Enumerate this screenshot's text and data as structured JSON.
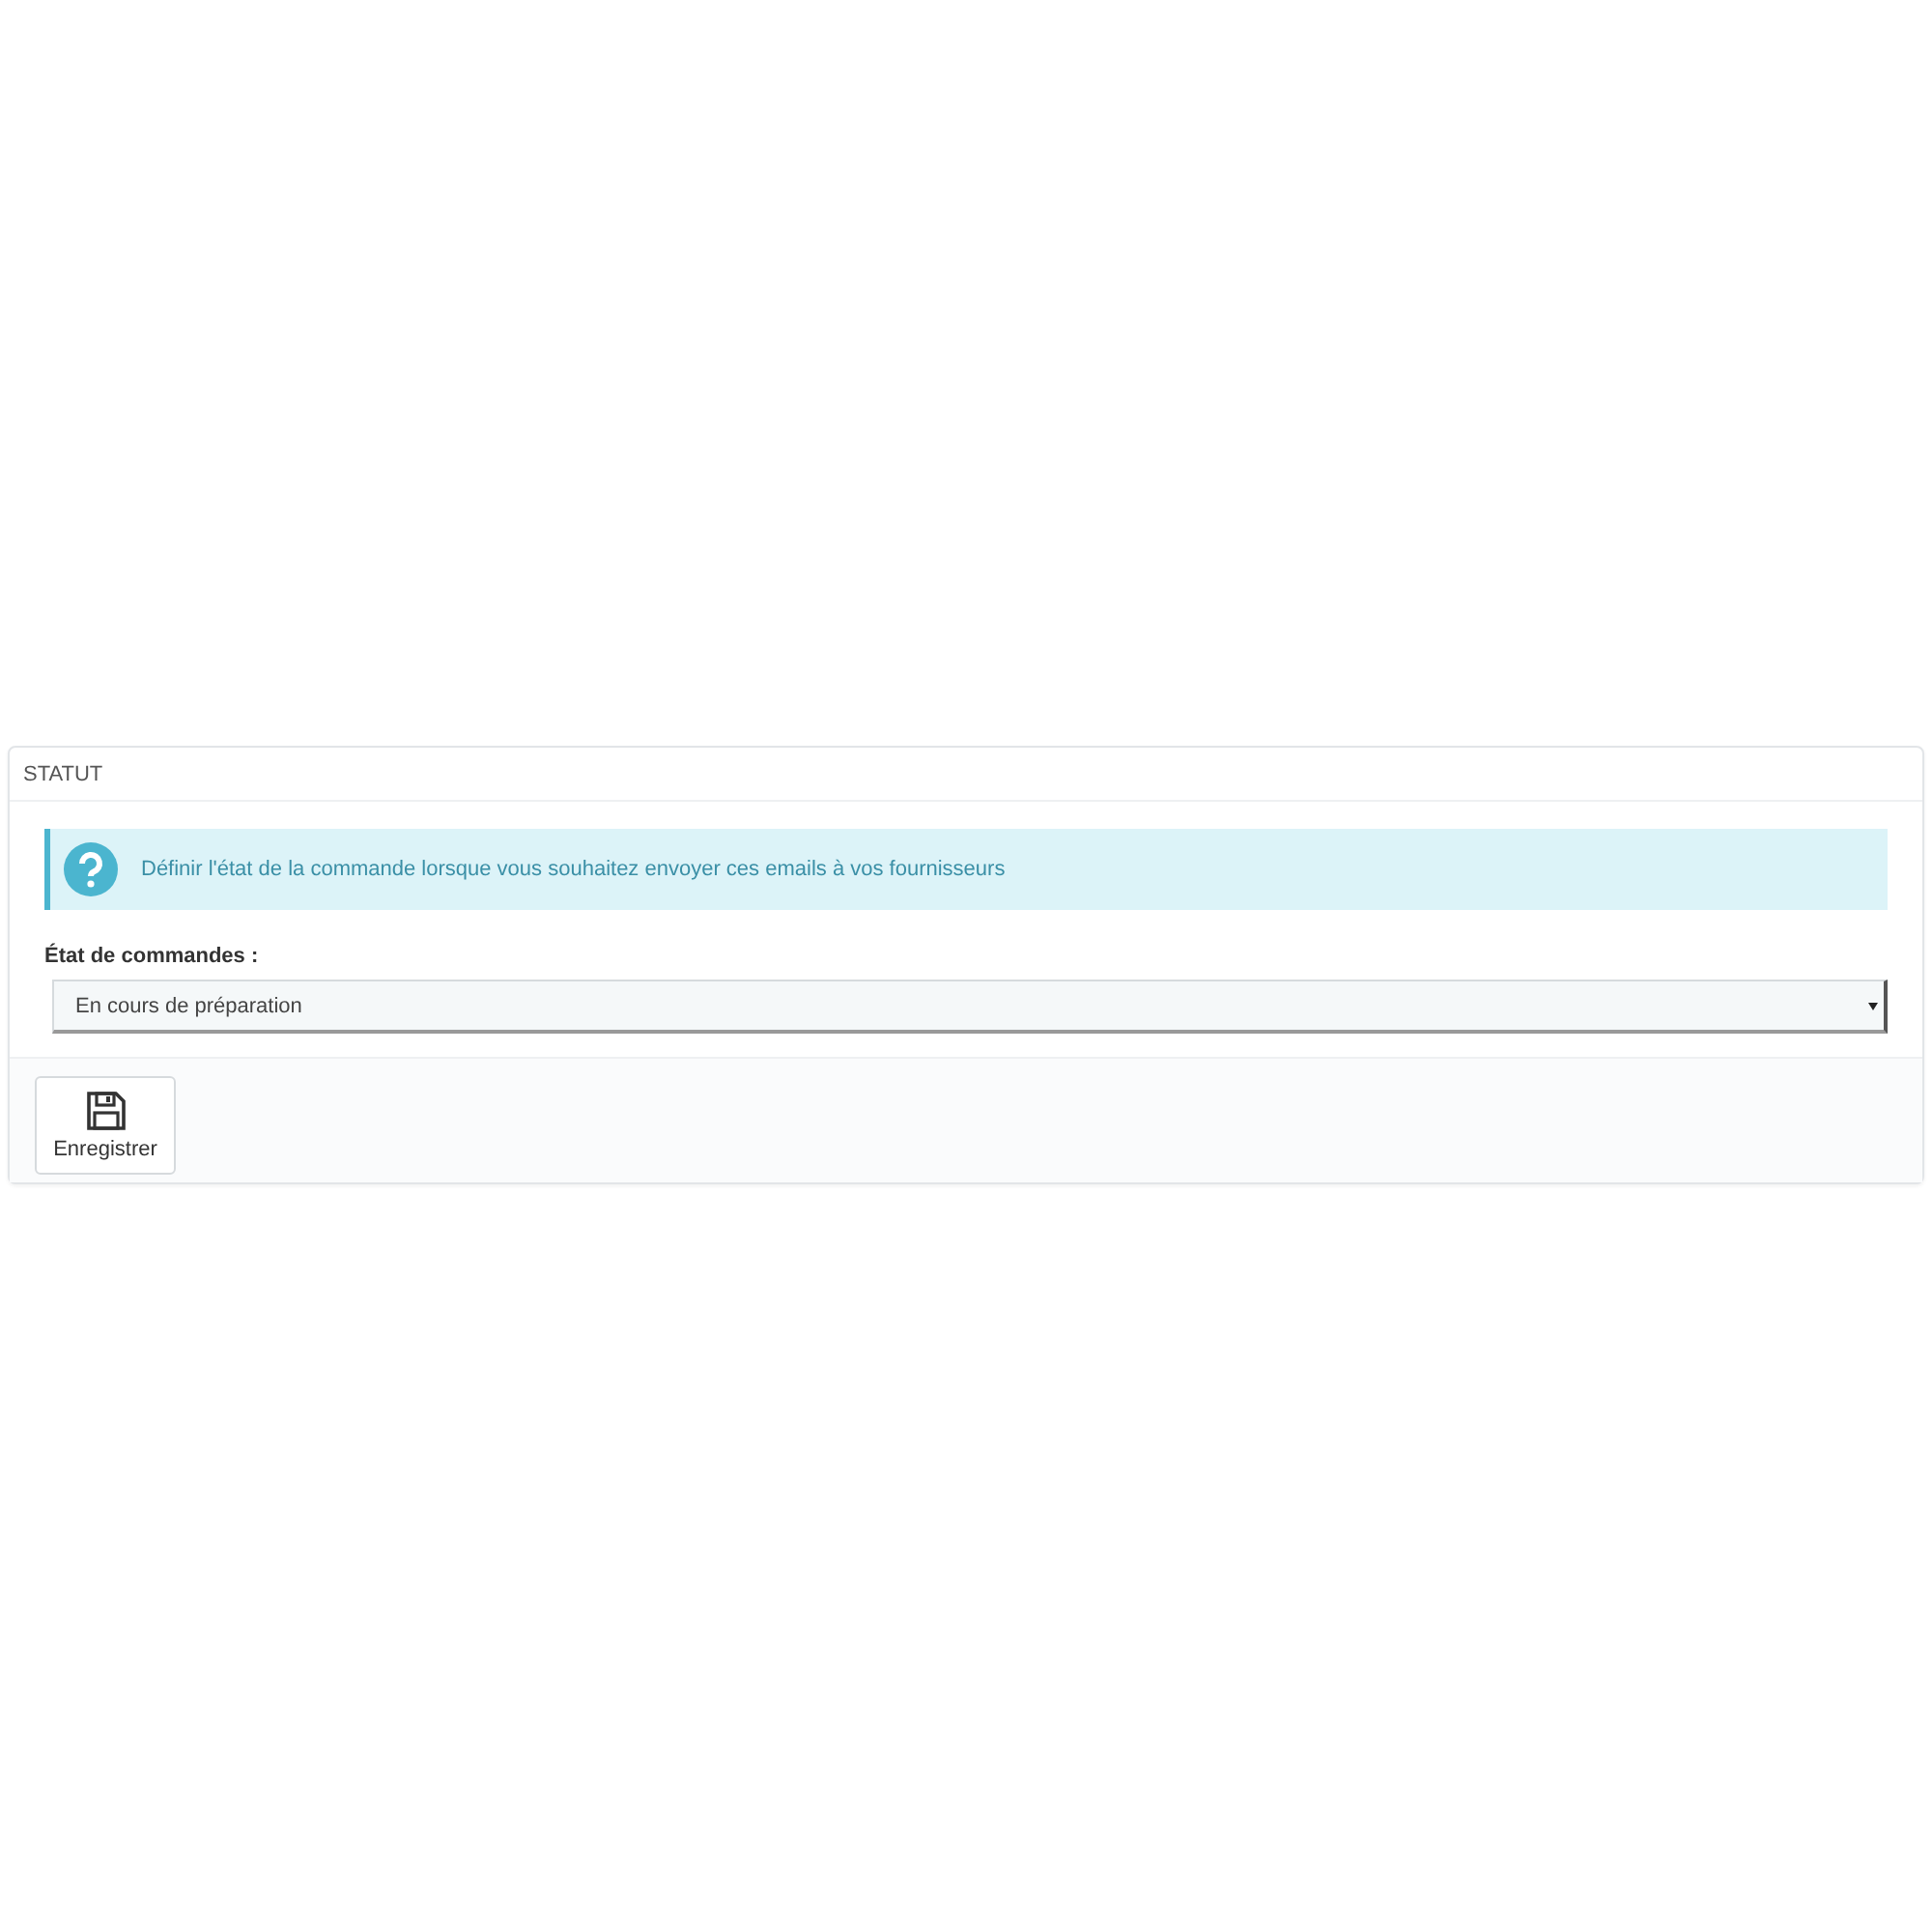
{
  "panel": {
    "title": "STATUT"
  },
  "alert": {
    "text": "Définir l'état de la commande lorsque vous souhaitez envoyer ces emails à vos fournisseurs"
  },
  "field": {
    "label": "État de commandes :",
    "value": "En cours de préparation"
  },
  "buttons": [
    {
      "label": "Enregistrer",
      "kind": "save"
    }
  ]
}
